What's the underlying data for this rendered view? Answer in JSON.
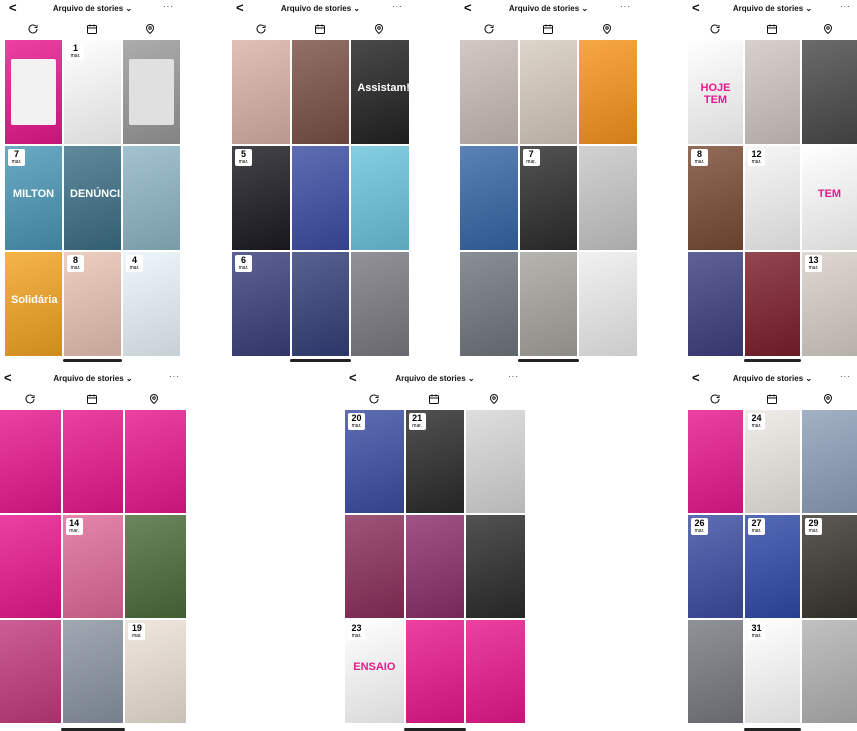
{
  "ui": {
    "title": "Arquivo de stories",
    "back": "<",
    "more": "···"
  },
  "icons": [
    "refresh-icon",
    "calendar-icon",
    "location-icon"
  ],
  "panels": [
    {
      "cells": [
        {
          "bg": "#e8188d",
          "inner": "#f2f2f2"
        },
        {
          "bg": "#ffffff",
          "date": "1",
          "month": "mar.",
          "text": ""
        },
        {
          "bg": "#9a9a9a",
          "inner": "#e0e0e0"
        },
        {
          "bg": "#4a97b7",
          "date": "7",
          "month": "mar.",
          "text": "MILTON"
        },
        {
          "bg": "#3c6f86",
          "text": "DENÚNCIA"
        },
        {
          "bg": "#8eb6c4"
        },
        {
          "bg": "#f3a422",
          "text": "Solidária"
        },
        {
          "bg": "#e9c3b4",
          "date": "8",
          "month": "mar."
        },
        {
          "bg": "#eaf5fb",
          "date": "4",
          "month": "mar."
        }
      ]
    },
    {
      "cells": [
        {
          "bg": "#d8b3a6"
        },
        {
          "bg": "#7a5146"
        },
        {
          "bg": "#222",
          "text": "Assistam!!"
        },
        {
          "bg": "#1b1b22",
          "date": "5",
          "month": "mar."
        },
        {
          "bg": "#3b4da3"
        },
        {
          "bg": "#6bc4dc"
        },
        {
          "bg": "#3a3f7b",
          "date": "6",
          "month": "mar."
        },
        {
          "bg": "#33407a"
        },
        {
          "bg": "#7b7a82"
        }
      ]
    },
    {
      "cells": [
        {
          "bg": "#c9bcb7"
        },
        {
          "bg": "#d6cbbf"
        },
        {
          "bg": "#f7941d"
        },
        {
          "bg": "#3567a6"
        },
        {
          "bg": "#2d2d2d",
          "date": "7",
          "month": "mar."
        },
        {
          "bg": "#c8c8c8"
        },
        {
          "bg": "#71767e"
        },
        {
          "bg": "#a6a49c"
        },
        {
          "bg": "#eeeeee"
        }
      ]
    },
    {
      "cells": [
        {
          "bg": "#ffffff",
          "text": "HOJE TEM"
        },
        {
          "bg": "#cfc6c1"
        },
        {
          "bg": "#4a4a4a"
        },
        {
          "bg": "#7a4b35",
          "date": "8",
          "month": "mar."
        },
        {
          "bg": "#f5f5f5",
          "date": "12",
          "month": "mar."
        },
        {
          "bg": "#ffffff",
          "text": "TEM"
        },
        {
          "bg": "#3d3f7f"
        },
        {
          "bg": "#7c1e2a"
        },
        {
          "bg": "#d8d0c8",
          "date": "13",
          "month": "mar."
        }
      ]
    },
    {
      "cells": [
        {
          "bg": "#e8188d"
        },
        {
          "bg": "#e8188d"
        },
        {
          "bg": "#e8188d"
        },
        {
          "bg": "#e8188d"
        },
        {
          "bg": "#e06b9a",
          "date": "14",
          "month": "mar."
        },
        {
          "bg": "#4b6c3a"
        },
        {
          "bg": "#c23a7e"
        },
        {
          "bg": "#8b96a2"
        },
        {
          "bg": "#ede2d7",
          "date": "19",
          "month": "mar."
        }
      ]
    },
    {
      "cells": [
        {
          "bg": "#3b4da3",
          "date": "20",
          "month": "mar."
        },
        {
          "bg": "#2b2b2b",
          "date": "21",
          "month": "mar."
        },
        {
          "bg": "#d7d7d7"
        },
        {
          "bg": "#8a2f5a"
        },
        {
          "bg": "#8b2f6a"
        },
        {
          "bg": "#2c2c2c"
        },
        {
          "bg": "#ffffff",
          "date": "23",
          "month": "mar.",
          "text": "ENSAIO"
        },
        {
          "bg": "#e8188d"
        },
        {
          "bg": "#e8188d"
        }
      ]
    },
    {
      "cells": [
        {
          "bg": "#e8188d"
        },
        {
          "bg": "#ece9e4",
          "date": "24",
          "month": "mar."
        },
        {
          "bg": "#8ea0b8"
        },
        {
          "bg": "#3b4da3",
          "date": "26",
          "month": "mar."
        },
        {
          "bg": "#2f4aa8",
          "date": "27",
          "month": "mar."
        },
        {
          "bg": "#3a3530",
          "date": "29",
          "month": "mar."
        },
        {
          "bg": "#777a80"
        },
        {
          "bg": "#ffffff",
          "date": "31",
          "month": "mar."
        },
        {
          "bg": "#b3b3b3"
        }
      ]
    }
  ]
}
